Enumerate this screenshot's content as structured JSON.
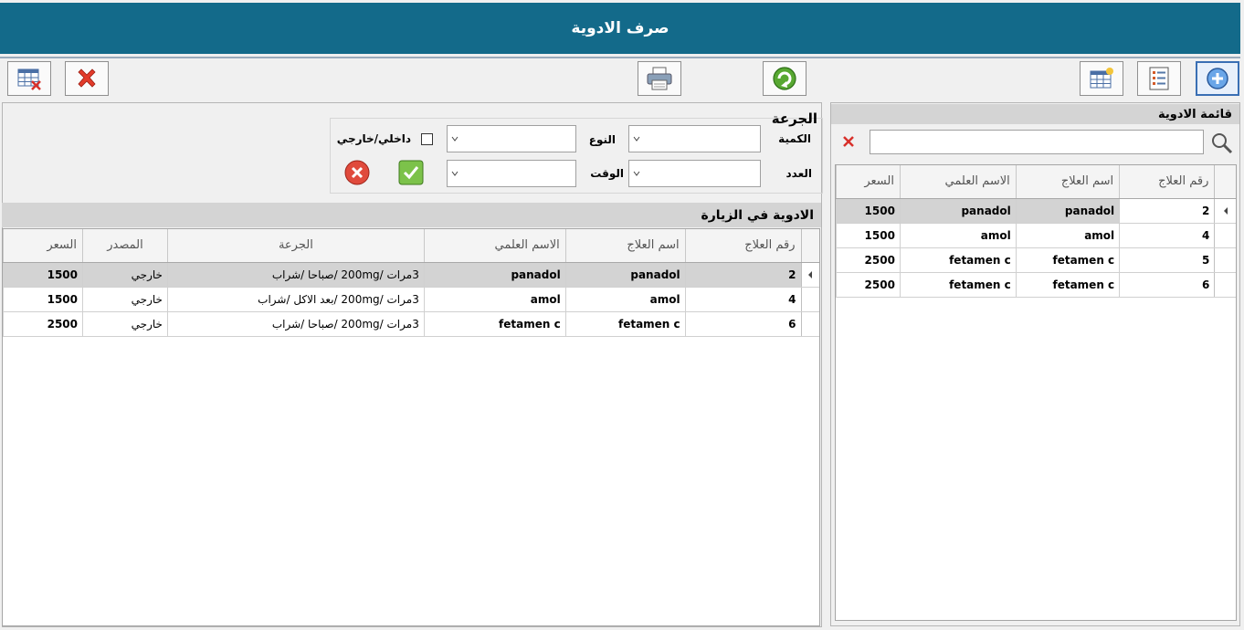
{
  "window": {
    "title": "صرف الادوية"
  },
  "toolbar": {
    "icons": [
      "add-icon",
      "list-icon",
      "new-grid-icon",
      "refresh-icon",
      "print-icon",
      "close-icon",
      "delete-grid-icon"
    ]
  },
  "dose": {
    "title": "الجرعة",
    "quantity_label": "الكمية",
    "type_label": "النوع",
    "count_label": "العدد",
    "time_label": "الوقت",
    "internal_external_label": "داخلي/خارجي",
    "quantity_value": "",
    "type_value": "",
    "count_value": "",
    "time_value": ""
  },
  "visit": {
    "title": "الادوية في الزيارة",
    "columns": [
      "رقم العلاج",
      "اسم العلاج",
      "الاسم العلمي",
      "الجرعة",
      "المصدر",
      "السعر"
    ],
    "rows": [
      [
        "2",
        "panadol",
        "panadol",
        "3مرات /200mg /صباحا /شراب",
        "خارجي",
        "1500"
      ],
      [
        "4",
        "amol",
        "amol",
        "3مرات /200mg /بعد الاكل /شراب",
        "خارجي",
        "1500"
      ],
      [
        "6",
        "fetamen c",
        "fetamen c",
        "3مرات /200mg /صباحا /شراب",
        "خارجي",
        "2500"
      ]
    ]
  },
  "drugs": {
    "title": "قائمة الادوية",
    "search_value": "",
    "columns": [
      "رقم العلاج",
      "اسم العلاج",
      "الاسم العلمي",
      "السعر"
    ],
    "rows": [
      [
        "2",
        "panadol",
        "panadol",
        "1500"
      ],
      [
        "4",
        "amol",
        "amol",
        "1500"
      ],
      [
        "5",
        "fetamen c",
        "fetamen c",
        "2500"
      ],
      [
        "6",
        "fetamen c",
        "fetamen c",
        "2500"
      ]
    ]
  }
}
